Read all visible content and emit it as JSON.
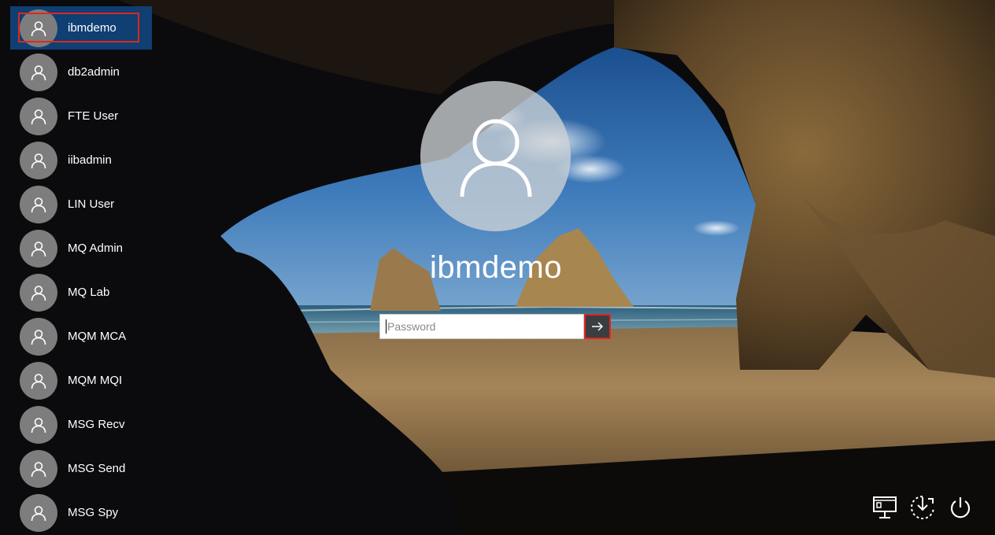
{
  "users": [
    {
      "label": "ibmdemo",
      "selected": true
    },
    {
      "label": "db2admin"
    },
    {
      "label": "FTE User"
    },
    {
      "label": "iibadmin"
    },
    {
      "label": "LIN User"
    },
    {
      "label": "MQ Admin"
    },
    {
      "label": "MQ Lab"
    },
    {
      "label": "MQM MCA"
    },
    {
      "label": "MQM MQI"
    },
    {
      "label": "MSG Recv"
    },
    {
      "label": "MSG Send"
    },
    {
      "label": "MSG Spy"
    }
  ],
  "login": {
    "username": "ibmdemo",
    "password_placeholder": "Password",
    "submit_icon": "arrow-right-icon"
  },
  "system_icons": [
    "network-icon",
    "ease-of-access-icon",
    "power-icon"
  ],
  "colors": {
    "selected_bg": "#0f3f73",
    "highlight": "#e0261c",
    "avatar": "#7d7d7d"
  }
}
